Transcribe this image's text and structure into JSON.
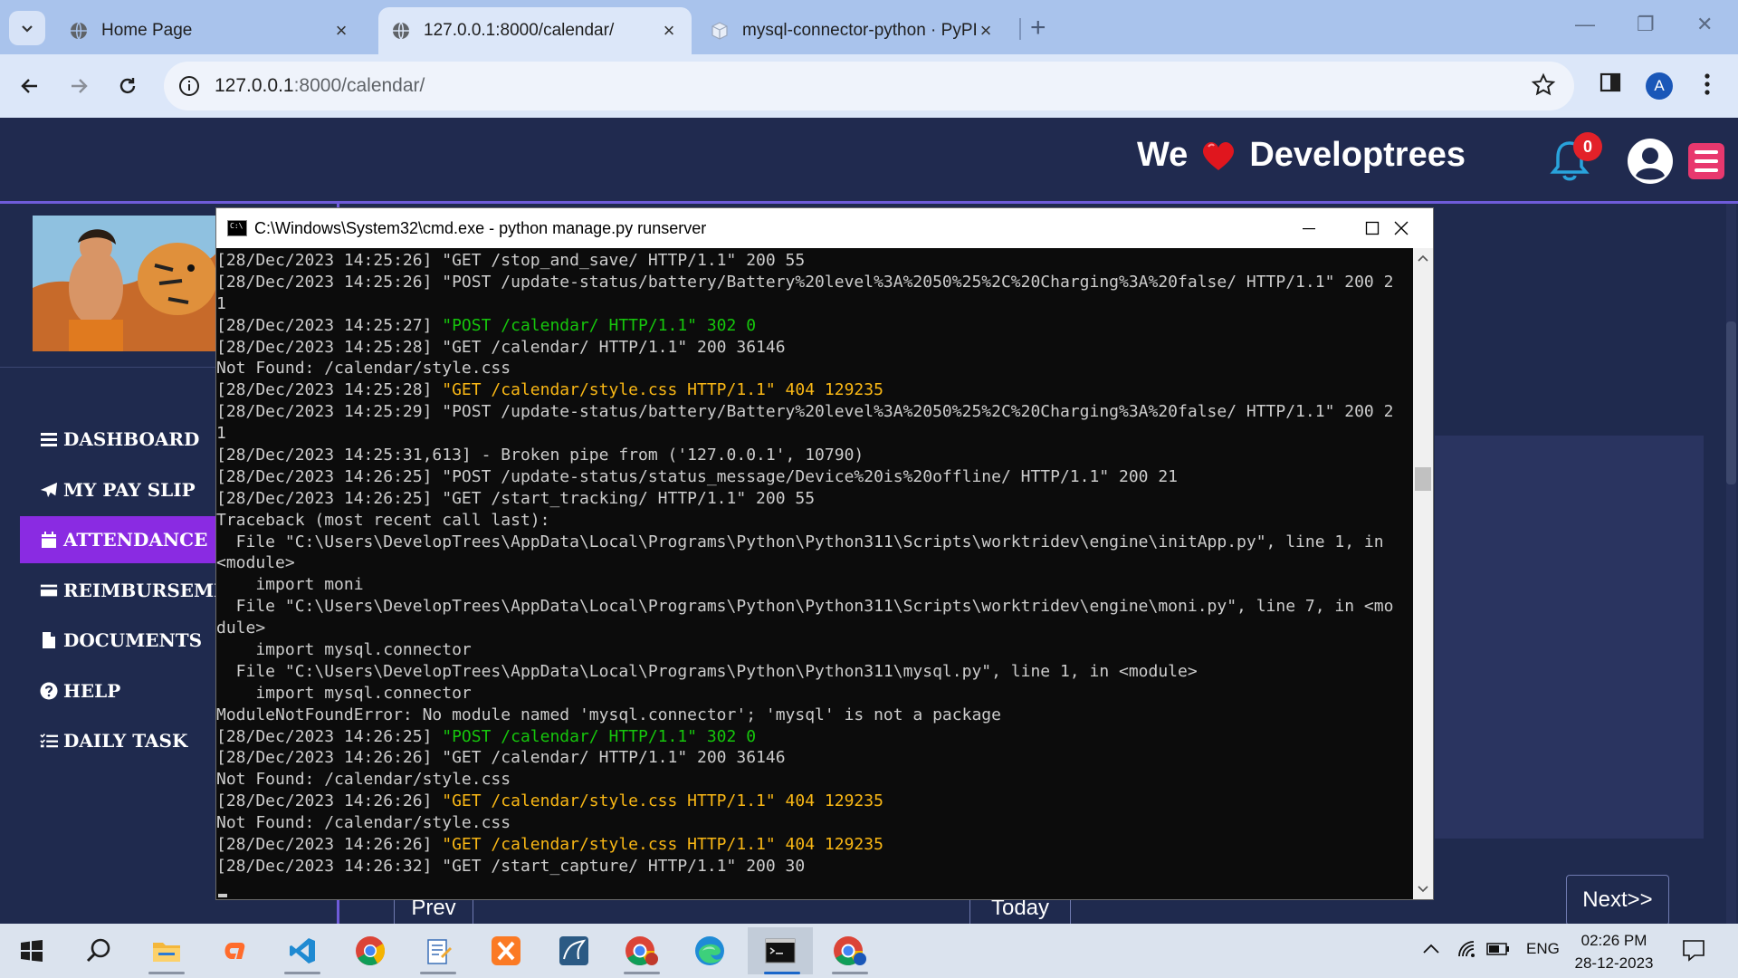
{
  "browser": {
    "tabs": [
      {
        "title": "Home Page",
        "active": false
      },
      {
        "title": "127.0.0.1:8000/calendar/",
        "active": true
      },
      {
        "title": "mysql-connector-python · PyPI",
        "active": false
      }
    ],
    "url_host": "127.0.0.1",
    "url_rest": ":8000/calendar/",
    "profile_initial": "A"
  },
  "site": {
    "brand_we": "We",
    "brand_name": "Developtrees",
    "notification_count": "0",
    "sidebar": [
      {
        "label": "DASHBOARD",
        "icon": "bars-icon",
        "active": false
      },
      {
        "label": "MY PAY SLIP",
        "icon": "paper-plane-icon",
        "active": false
      },
      {
        "label": "ATTENDANCE",
        "icon": "calendar-icon",
        "active": true
      },
      {
        "label": "REIMBURSEMENT",
        "icon": "credit-card-icon",
        "active": false
      },
      {
        "label": "DOCUMENTS",
        "icon": "file-icon",
        "active": false
      },
      {
        "label": "HELP",
        "icon": "question-circle-icon",
        "active": false
      },
      {
        "label": "DAILY TASK",
        "icon": "list-check-icon",
        "active": false
      }
    ],
    "calendar_buttons": {
      "prev": "Prev",
      "today": "Today",
      "next": "Next>>"
    }
  },
  "cmd": {
    "title": "C:\\Windows\\System32\\cmd.exe - python  manage.py runserver",
    "lines": [
      {
        "t": "[28/Dec/2023 14:25:26] \"GET /stop_and_save/ HTTP/1.1\" 200 55",
        "c": ""
      },
      {
        "t": "[28/Dec/2023 14:25:26] \"POST /update-status/battery/Battery%20level%3A%2050%25%2C%20Charging%3A%20false/ HTTP/1.1\" 200 2",
        "c": ""
      },
      {
        "t": "1",
        "c": ""
      },
      {
        "t": "[28/Dec/2023 14:25:27] ",
        "c": "",
        "h": "\"POST /calendar/ HTTP/1.1\" 302 0",
        "hc": "g"
      },
      {
        "t": "[28/Dec/2023 14:25:28] \"GET /calendar/ HTTP/1.1\" 200 36146",
        "c": ""
      },
      {
        "t": "Not Found: /calendar/style.css",
        "c": ""
      },
      {
        "t": "[28/Dec/2023 14:25:28] ",
        "c": "",
        "h": "\"GET /calendar/style.css HTTP/1.1\" 404 129235",
        "hc": "y"
      },
      {
        "t": "[28/Dec/2023 14:25:29] \"POST /update-status/battery/Battery%20level%3A%2050%25%2C%20Charging%3A%20false/ HTTP/1.1\" 200 2",
        "c": ""
      },
      {
        "t": "1",
        "c": ""
      },
      {
        "t": "[28/Dec/2023 14:25:31,613] - Broken pipe from ('127.0.0.1', 10790)",
        "c": ""
      },
      {
        "t": "[28/Dec/2023 14:26:25] \"POST /update-status/status_message/Device%20is%20offline/ HTTP/1.1\" 200 21",
        "c": ""
      },
      {
        "t": "[28/Dec/2023 14:26:25] \"GET /start_tracking/ HTTP/1.1\" 200 55",
        "c": ""
      },
      {
        "t": "Traceback (most recent call last):",
        "c": ""
      },
      {
        "t": "  File \"C:\\Users\\DevelopTrees\\AppData\\Local\\Programs\\Python\\Python311\\Scripts\\worktridev\\engine\\initApp.py\", line 1, in",
        "c": ""
      },
      {
        "t": "<module>",
        "c": ""
      },
      {
        "t": "    import moni",
        "c": ""
      },
      {
        "t": "  File \"C:\\Users\\DevelopTrees\\AppData\\Local\\Programs\\Python\\Python311\\Scripts\\worktridev\\engine\\moni.py\", line 7, in <mo",
        "c": ""
      },
      {
        "t": "dule>",
        "c": ""
      },
      {
        "t": "    import mysql.connector",
        "c": ""
      },
      {
        "t": "  File \"C:\\Users\\DevelopTrees\\AppData\\Local\\Programs\\Python\\Python311\\mysql.py\", line 1, in <module>",
        "c": ""
      },
      {
        "t": "    import mysql.connector",
        "c": ""
      },
      {
        "t": "ModuleNotFoundError: No module named 'mysql.connector'; 'mysql' is not a package",
        "c": ""
      },
      {
        "t": "[28/Dec/2023 14:26:25] ",
        "c": "",
        "h": "\"POST /calendar/ HTTP/1.1\" 302 0",
        "hc": "g"
      },
      {
        "t": "[28/Dec/2023 14:26:26] \"GET /calendar/ HTTP/1.1\" 200 36146",
        "c": ""
      },
      {
        "t": "Not Found: /calendar/style.css",
        "c": ""
      },
      {
        "t": "[28/Dec/2023 14:26:26] ",
        "c": "",
        "h": "\"GET /calendar/style.css HTTP/1.1\" 404 129235",
        "hc": "y"
      },
      {
        "t": "Not Found: /calendar/style.css",
        "c": ""
      },
      {
        "t": "[28/Dec/2023 14:26:26] ",
        "c": "",
        "h": "\"GET /calendar/style.css HTTP/1.1\" 404 129235",
        "hc": "y"
      },
      {
        "t": "[28/Dec/2023 14:26:32] \"GET /start_capture/ HTTP/1.1\" 200 30",
        "c": ""
      }
    ]
  },
  "taskbar": {
    "apps": [
      "start-icon",
      "search-icon",
      "file-explorer-icon",
      "cpanel-icon",
      "vscode-icon",
      "chrome-icon",
      "notepad-icon",
      "xampp-icon",
      "mysql-workbench-icon",
      "chrome-profile-icon",
      "edge-icon",
      "cmd-icon",
      "chrome-icon-2"
    ],
    "language": "ENG",
    "time": "02:26 PM",
    "date": "28-12-2023"
  },
  "colors": {
    "accent": "#8a2be2",
    "header_bg": "#202a4f",
    "cmd_green": "#16c60c",
    "cmd_yellow": "#f9b715"
  }
}
